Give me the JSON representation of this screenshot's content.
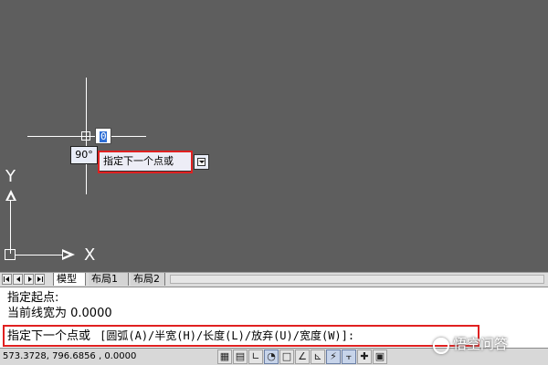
{
  "canvas": {
    "angle_tooltip": "90°",
    "dynamic_prompt": "指定下一个点或",
    "dynamic_input_value": "0",
    "ucs_x_label": "X",
    "ucs_y_label": "Y"
  },
  "tabs": {
    "model": "模型",
    "layout1": "布局1",
    "layout2": "布局2"
  },
  "command_window": {
    "history": [
      "指定起点:",
      "当前线宽为 0.0000"
    ],
    "current_prompt": "指定下一个点或",
    "current_options": "[圆弧(A)/半宽(H)/长度(L)/放弃(U)/宽度(W)]:"
  },
  "status_bar": {
    "coordinates": "573.3728,   796.6856 , 0.0000"
  },
  "watermark": {
    "text": "悟空问答"
  },
  "colors": {
    "canvas_bg": "#5e5e5e",
    "highlight_red": "#e02020",
    "tooltip_bg": "#ededf6"
  }
}
